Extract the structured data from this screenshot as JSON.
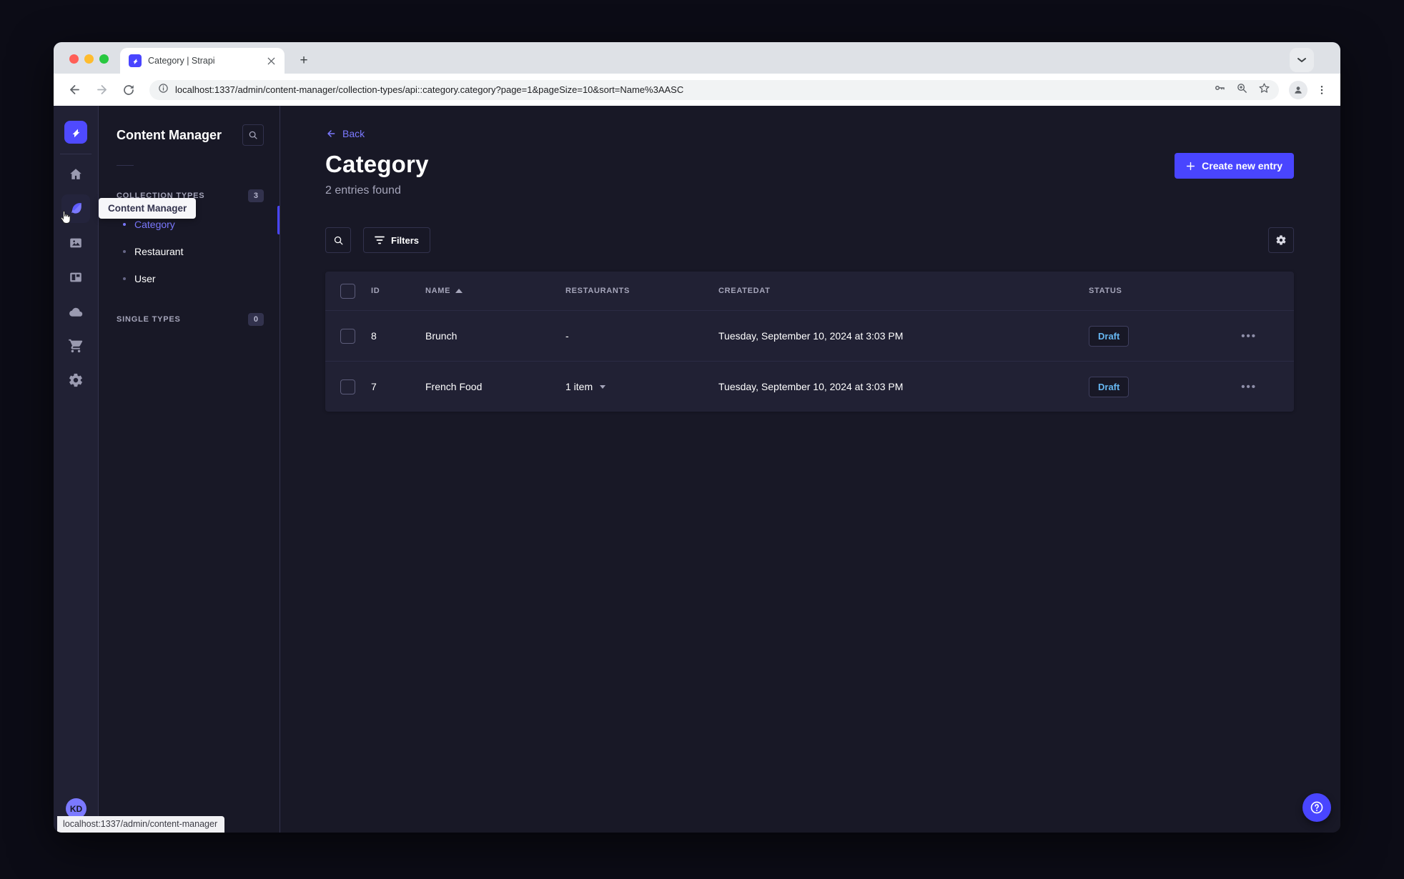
{
  "browser": {
    "tab_title": "Category | Strapi",
    "url": "localhost:1337/admin/content-manager/collection-types/api::category.category?page=1&pageSize=10&sort=Name%3AASC",
    "status_tooltip": "localhost:1337/admin/content-manager",
    "new_tab_label": "+"
  },
  "sidebar": {
    "workspace_initials": "KD"
  },
  "subnav": {
    "title": "Content Manager",
    "tooltip": "Content Manager",
    "sections": [
      {
        "label": "COLLECTION TYPES",
        "count": "3",
        "items": [
          {
            "label": "Category",
            "active": true
          },
          {
            "label": "Restaurant",
            "active": false
          },
          {
            "label": "User",
            "active": false
          }
        ]
      },
      {
        "label": "SINGLE TYPES",
        "count": "0",
        "items": []
      }
    ]
  },
  "main": {
    "back_label": "Back",
    "title": "Category",
    "subtitle": "2 entries found",
    "create_button": "Create new entry",
    "filters_button": "Filters",
    "table": {
      "headers": {
        "id": "ID",
        "name": "NAME",
        "restaurants": "RESTAURANTS",
        "createdat": "CREATEDAT",
        "status": "STATUS"
      },
      "rows": [
        {
          "id": "8",
          "name": "Brunch",
          "restaurants": "-",
          "createdat": "Tuesday, September 10, 2024 at 3:03 PM",
          "status": "Draft"
        },
        {
          "id": "7",
          "name": "French Food",
          "restaurants": "1 item",
          "createdat": "Tuesday, September 10, 2024 at 3:03 PM",
          "status": "Draft"
        }
      ]
    }
  },
  "colors": {
    "accent": "#4945ff",
    "accent_light": "#7b79ff",
    "draft_text": "#66b7f1",
    "app_background": "#181826",
    "surface": "#212134",
    "border": "#32324d"
  }
}
